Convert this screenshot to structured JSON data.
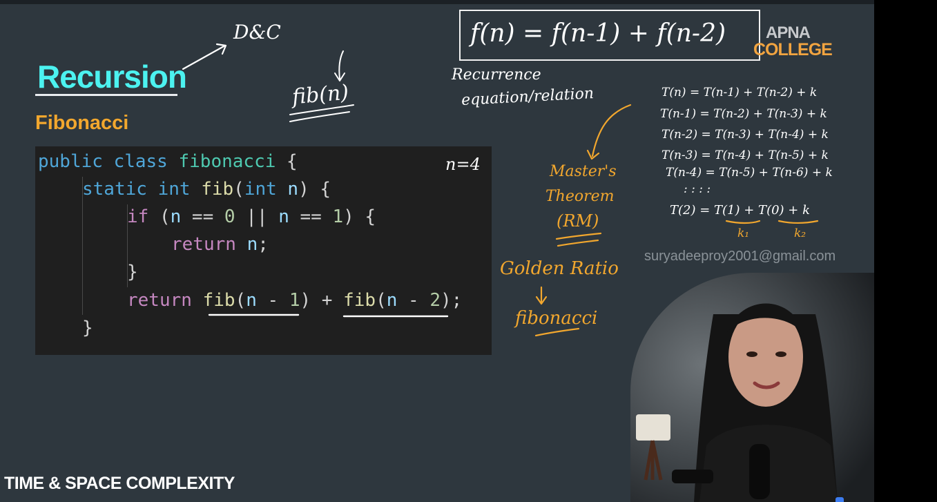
{
  "slide": {
    "title": "Recursion",
    "subtitle": "Fibonacci",
    "footer": "TIME & SPACE COMPLEXITY",
    "email": "suryadeeproy2001@gmail.com",
    "logo": {
      "line1": "APNA",
      "line2": "COLLEGE"
    }
  },
  "code": {
    "line1": {
      "a": "public class ",
      "b": "fibonacci",
      "c": " {"
    },
    "line2": {
      "a": "static int ",
      "b": "fib",
      "c": "(",
      "d": "int",
      "e": " n",
      "f": ") {"
    },
    "line3": {
      "a": "if",
      "b": " (",
      "c": "n",
      "d": " == ",
      "e": "0",
      "f": " || ",
      "g": "n",
      "h": " == ",
      "i": "1",
      "j": ") {"
    },
    "line4": {
      "a": "return",
      "b": " n",
      "c": ";"
    },
    "line5": "}",
    "line6": {
      "a": "return",
      "b": " fib",
      "c": "(",
      "d": "n",
      "e": " - ",
      "f": "1",
      "g": ") + ",
      "h": "fib",
      "i": "(",
      "j": "n",
      "k": " - ",
      "l": "2",
      "m": ");"
    },
    "line7": "}"
  },
  "annotations": {
    "dc": "D&C",
    "fib_n": "fib(n)",
    "n_equals": "n=4",
    "formula": "f(n) =  f(n-1) + f(n-2)",
    "recurrence_1": "Recurrence",
    "recurrence_2": "equation/relation",
    "masters_1": "Master's",
    "masters_2": "Theorem",
    "masters_3": "(RM)",
    "golden_ratio": "Golden Ratio",
    "fibonacci": "fibonacci",
    "recurrence_lines": [
      "T(n) = T(n-1) + T(n-2) + k",
      "T(n-1) = T(n-2) + T(n-3) + k",
      "T(n-2) = T(n-3) + T(n-4) + k",
      "T(n-3) = T(n-4) + T(n-5) + k",
      "T(n-4) = T(n-5) + T(n-6) + k",
      ":          :          :     :",
      "T(2) = T(1) + T(0) + k"
    ],
    "k1": "k₁",
    "k2": "k₂"
  },
  "colors": {
    "background": "#2e373e",
    "title": "#4cf2f0",
    "accent_orange": "#f2a72e",
    "code_bg": "#1f1f1f"
  }
}
